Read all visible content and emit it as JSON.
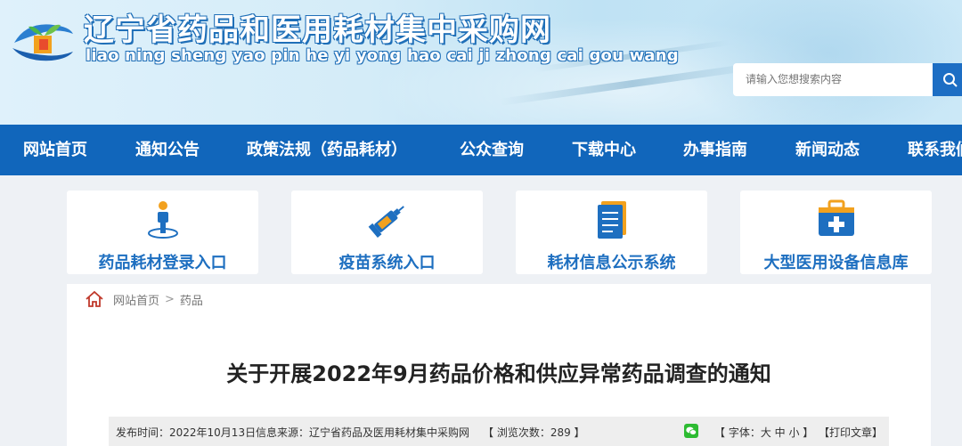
{
  "header": {
    "title_cn": "辽宁省药品和医用耗材集中采购网",
    "title_pinyin": "liao ning sheng yao pin he yi yong hao cai ji zhong cai gou wang",
    "search_placeholder": "请输入您想搜索内容",
    "logo_icon": "leaf-cube-logo",
    "search_icon": "search-icon"
  },
  "nav": {
    "items": [
      "网站首页",
      "通知公告",
      "政策法规（药品耗材）",
      "公众查询",
      "下载中心",
      "办事指南",
      "新闻动态",
      "联系我们"
    ]
  },
  "entries": [
    {
      "label": "药品耗材登录入口",
      "icon": "person-login-icon"
    },
    {
      "label": "疫苗系统入口",
      "icon": "syringe-icon"
    },
    {
      "label": "耗材信息公示系统",
      "icon": "document-list-icon"
    },
    {
      "label": "大型医用设备信息库",
      "icon": "medical-kit-icon"
    }
  ],
  "breadcrumb": {
    "home": "网站首页",
    "separator": ">",
    "current": "药品"
  },
  "article": {
    "title": "关于开展2022年9月药品价格和供应异常药品调查的通知",
    "published": "发布时间：2022年10月13日",
    "source": "信息来源：辽宁省药品及医用耗材集中采购网",
    "views": "【 浏览次数：289 】",
    "font_size_label": "【 字体：大 中 小 】",
    "print_label": "【打印文章】"
  },
  "colors": {
    "nav_bg": "#1166bb",
    "accent_blue": "#1e6fc0",
    "entry_label": "#1e6fc0",
    "page_bg": "#eef1f5"
  }
}
